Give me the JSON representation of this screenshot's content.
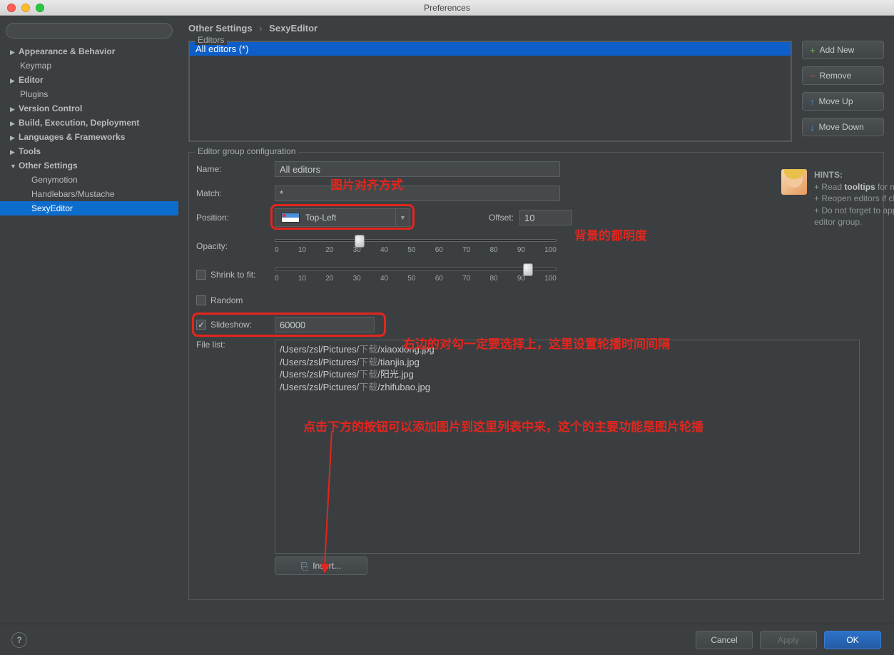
{
  "window": {
    "title": "Preferences"
  },
  "sidebar": {
    "items": [
      {
        "label": "Appearance & Behavior",
        "exp": false,
        "level": 0
      },
      {
        "label": "Keymap",
        "leaf": true,
        "level": 0
      },
      {
        "label": "Editor",
        "exp": false,
        "level": 0
      },
      {
        "label": "Plugins",
        "leaf": true,
        "level": 0
      },
      {
        "label": "Version Control",
        "exp": false,
        "level": 0
      },
      {
        "label": "Build, Execution, Deployment",
        "exp": false,
        "level": 0
      },
      {
        "label": "Languages & Frameworks",
        "exp": false,
        "level": 0
      },
      {
        "label": "Tools",
        "exp": false,
        "level": 0
      },
      {
        "label": "Other Settings",
        "exp": true,
        "level": 0
      },
      {
        "label": "Genymotion",
        "leaf": true,
        "level": 1
      },
      {
        "label": "Handlebars/Mustache",
        "leaf": true,
        "level": 1
      },
      {
        "label": "SexyEditor",
        "leaf": true,
        "level": 1,
        "selected": true
      }
    ]
  },
  "breadcrumb": {
    "a": "Other Settings",
    "b": "SexyEditor"
  },
  "editors": {
    "group_label": "Editors",
    "selected": "All editors (*)",
    "buttons": {
      "add": "Add New",
      "remove": "Remove",
      "up": "Move Up",
      "down": "Move Down"
    }
  },
  "config": {
    "group_label": "Editor group configuration",
    "name_label": "Name:",
    "name_value": "All editors",
    "match_label": "Match:",
    "match_value": "*",
    "position_label": "Position:",
    "position_value": "Top-Left",
    "offset_label": "Offset:",
    "offset_value": "10",
    "opacity_label": "Opacity:",
    "opacity_value": 30,
    "shrink_label": "Shrink to fit:",
    "shrink_value": 90,
    "shrink_checked": false,
    "random_label": "Random",
    "random_checked": false,
    "slideshow_label": "Slideshow:",
    "slideshow_checked": true,
    "slideshow_value": "60000",
    "filelist_label": "File list:",
    "files": [
      {
        "pre": "/Users/zsl/Pictures/",
        "cn": "下载",
        "post": "/xiaoxiong.jpg"
      },
      {
        "pre": "/Users/zsl/Pictures/",
        "cn": "下载",
        "post": "/tianjia.jpg"
      },
      {
        "pre": "/Users/zsl/Pictures/",
        "cn": "下载",
        "post": "/阳光.jpg"
      },
      {
        "pre": "/Users/zsl/Pictures/",
        "cn": "下载",
        "post": "/zhifubao.jpg"
      }
    ],
    "insert_label": "Insert...",
    "slider_ticks": [
      "0",
      "10",
      "20",
      "30",
      "40",
      "50",
      "60",
      "70",
      "80",
      "90",
      "100"
    ]
  },
  "hints": {
    "title": "HINTS:",
    "l1a": "+ Read ",
    "l1b": "tooltips",
    "l1c": " for more help.",
    "l2": "+ Reopen editors if changes are not visible.",
    "l3": "+ Do not forget to apply changes before changing the editor group."
  },
  "annotations": {
    "a1": "图片对齐方式",
    "a2": "背景的都明度",
    "a3": "右边的对勾一定要选择上，这里设置轮播时间间隔",
    "a4": "点击下方的按钮可以添加图片到这里列表中来，这个的主要功能是图片轮播"
  },
  "footer": {
    "cancel": "Cancel",
    "apply": "Apply",
    "ok": "OK"
  }
}
